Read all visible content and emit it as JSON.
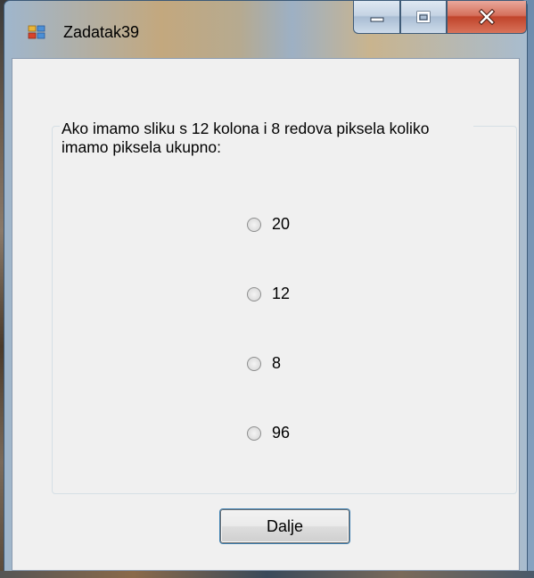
{
  "window": {
    "title": "Zadatak39",
    "icon": "app-window-icon",
    "controls": [
      "minimize-icon",
      "maximize-icon",
      "close-icon"
    ]
  },
  "question": {
    "text": "Ako imamo sliku s 12 kolona i 8 redova piksela koliko imamo piksela ukupno:"
  },
  "options": [
    {
      "label": "20",
      "selected": false
    },
    {
      "label": "12",
      "selected": false
    },
    {
      "label": "8",
      "selected": false
    },
    {
      "label": "96",
      "selected": false
    }
  ],
  "next_button": {
    "label": "Dalje"
  },
  "colors": {
    "client_bg": "#f0f0f0",
    "close_button": "#c9492f",
    "button_focus": "#3c7fb1"
  }
}
